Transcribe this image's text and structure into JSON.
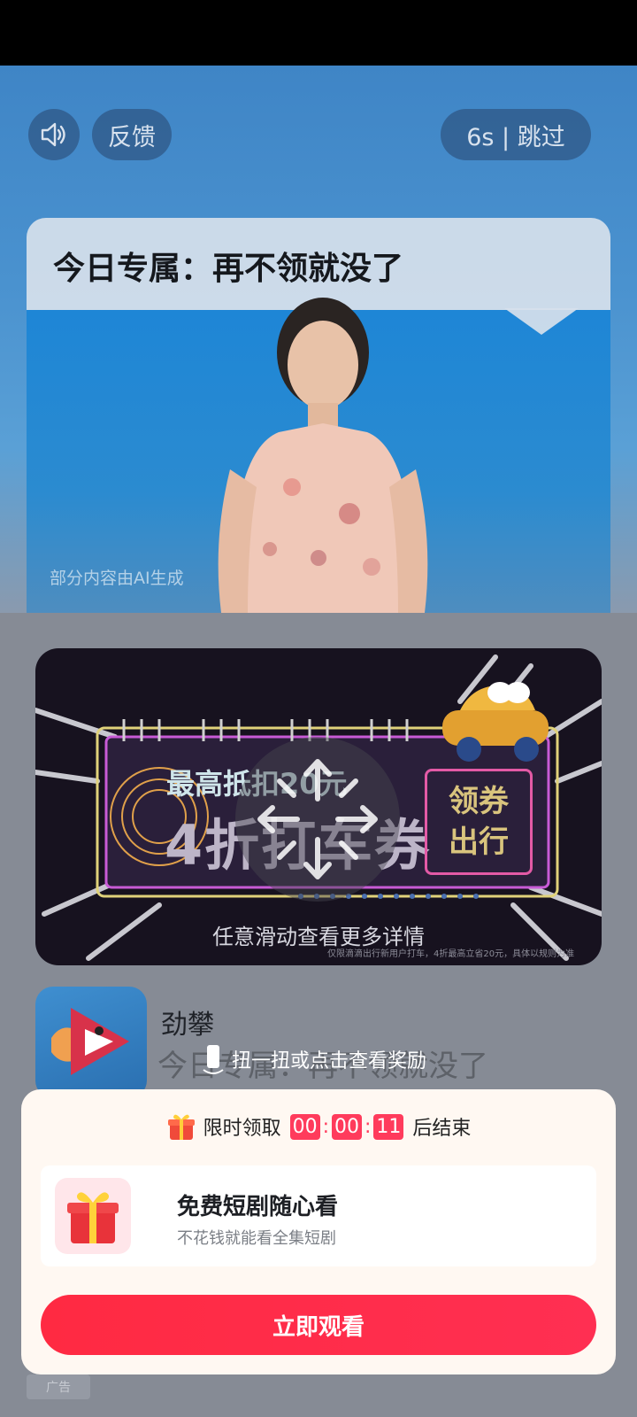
{
  "top_controls": {
    "sound_icon": "speaker-icon",
    "feedback_label": "反馈",
    "skip_label": "6s | 跳过"
  },
  "hero": {
    "speech_text": "今日专属：再不领就没了",
    "ai_note": "部分内容由AI生成"
  },
  "banner": {
    "subtitle": "最高抵扣20元",
    "main": "4折打车券",
    "button_line1": "领券",
    "button_line2": "出行",
    "hint": "任意滑动查看更多详情",
    "fine_print": "仅限滴滴出行新用户打车，4折最高立省20元，具体以规则为准"
  },
  "app": {
    "name": "劲攀",
    "description": "今日专属：再不领就没了",
    "shake_hint": "扭一扭或点击查看奖励"
  },
  "card": {
    "timer_prefix": "限时领取",
    "timer": [
      "00",
      "00",
      "11"
    ],
    "timer_suffix": "后结束",
    "title": "免费短剧随心看",
    "subtitle": "不花钱就能看全集短剧",
    "cta_label": "立即观看"
  },
  "ad_tag": "广告",
  "colors": {
    "accent_red": "#ff2a42",
    "timer_red": "#ff3b5c",
    "banner_pink": "#e35aa6"
  }
}
